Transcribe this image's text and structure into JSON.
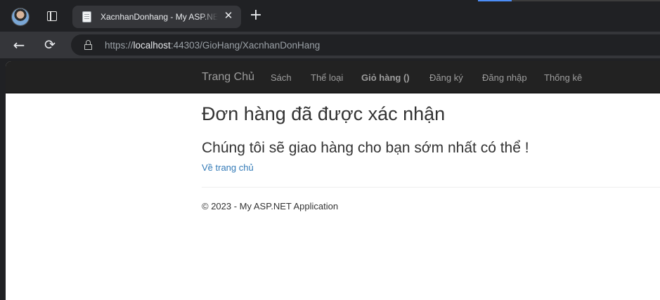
{
  "browser": {
    "tab_title": "XacnhanDonhang - My ASP.NET Application",
    "url_scheme": "https://",
    "url_host": "localhost",
    "url_rest": ":44303/GioHang/XacnhanDonHang",
    "icons": {
      "avatar": "profile-avatar",
      "tab_actions": "tab-actions-icon",
      "favicon": "document-icon",
      "close": "close-icon",
      "new_tab": "plus-icon",
      "back": "back-arrow-icon",
      "reload": "reload-icon",
      "lock": "lock-icon"
    },
    "close_glyph": "✕",
    "new_tab_glyph": "+",
    "back_glyph": "←",
    "reload_glyph": "⟳"
  },
  "navbar": {
    "brand": "Trang Chủ",
    "links": [
      "Sách",
      "Thể loại",
      "Giỏ hàng ()",
      "Đăng ký",
      "Đăng nhập",
      "Thống kê"
    ]
  },
  "main": {
    "heading": "Đơn hàng đã được xác nhận",
    "message": "Chúng tôi sẽ giao hàng cho bạn sớm nhất có thể !",
    "home_link": "Về trang chủ"
  },
  "footer": {
    "text": "© 2023 - My ASP.NET Application"
  },
  "colors": {
    "browser_bg": "#202124",
    "toolbar_bg": "#35363a",
    "navbar_bg": "#222222",
    "link": "#337ab7"
  }
}
